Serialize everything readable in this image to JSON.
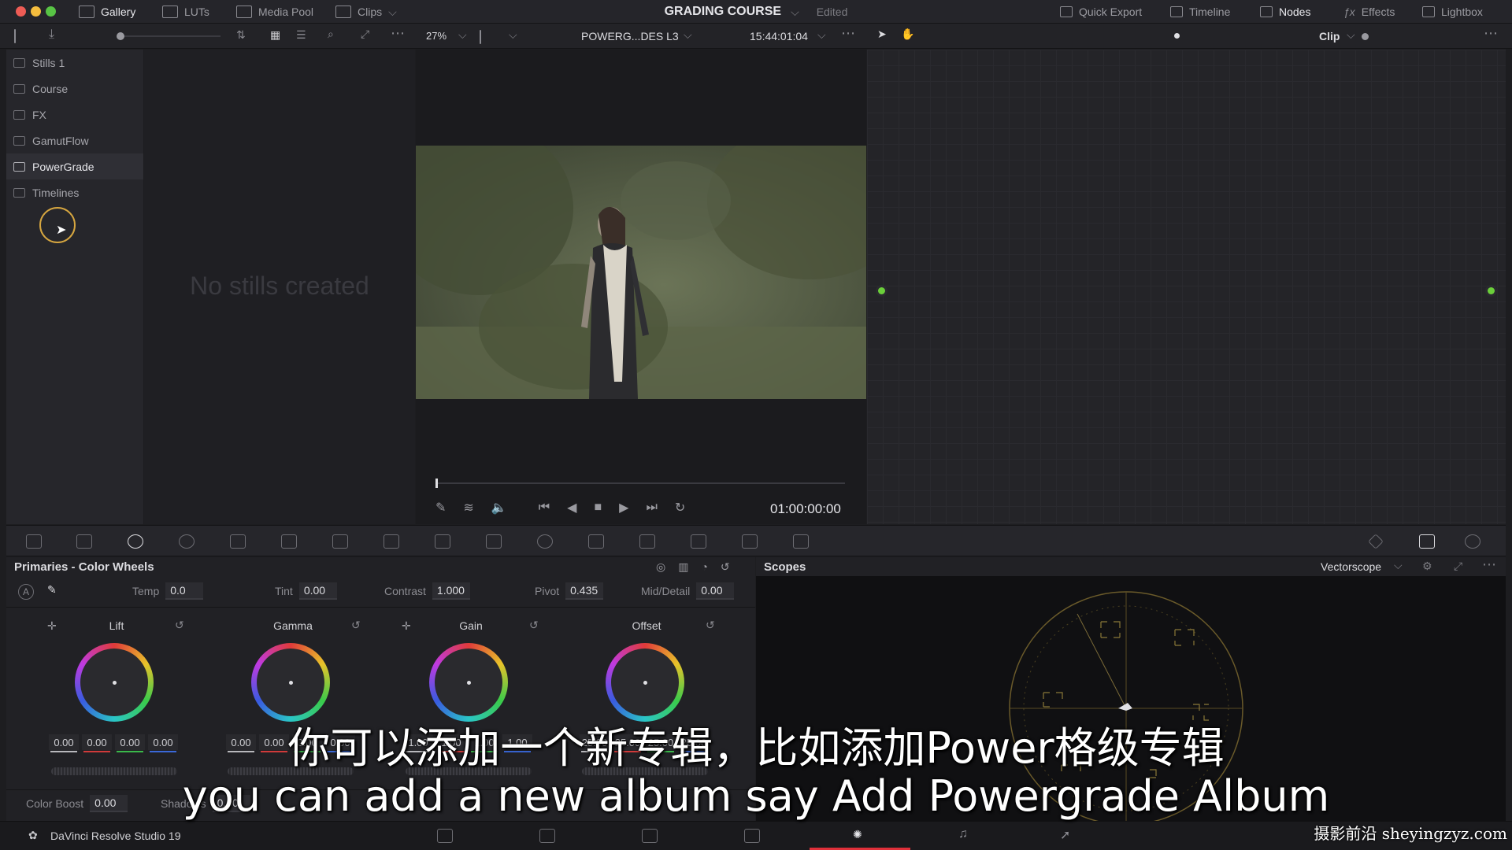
{
  "topbar": {
    "tabs": [
      {
        "label": "Gallery",
        "active": true
      },
      {
        "label": "LUTs",
        "active": false
      },
      {
        "label": "Media Pool",
        "active": false
      },
      {
        "label": "Clips",
        "active": false
      }
    ],
    "project_title": "GRADING COURSE",
    "status": "Edited",
    "right_tabs": [
      {
        "label": "Quick Export"
      },
      {
        "label": "Timeline"
      },
      {
        "label": "Nodes"
      },
      {
        "label": "Effects"
      },
      {
        "label": "Lightbox"
      }
    ]
  },
  "toolbar2": {
    "zoom": "27%",
    "clip_name": "POWERG...DES L3",
    "timecode": "15:44:01:04",
    "node_mode": "Clip"
  },
  "albums": [
    {
      "label": "Stills 1",
      "selected": false
    },
    {
      "label": "Course",
      "selected": false
    },
    {
      "label": "FX",
      "selected": false
    },
    {
      "label": "GamutFlow",
      "selected": false
    },
    {
      "label": "PowerGrade",
      "selected": true
    },
    {
      "label": "Timelines",
      "selected": false
    }
  ],
  "stills": {
    "empty_text": "No stills created"
  },
  "viewer": {
    "playhead_timecode": "01:00:00:00"
  },
  "primaries": {
    "title": "Primaries - Color Wheels",
    "params": {
      "temp_label": "Temp",
      "temp": "0.0",
      "tint_label": "Tint",
      "tint": "0.00",
      "contrast_label": "Contrast",
      "contrast": "1.000",
      "pivot_label": "Pivot",
      "pivot": "0.435",
      "middetail_label": "Mid/Detail",
      "middetail": "0.00"
    },
    "wheels": [
      {
        "label": "Lift",
        "values": [
          "0.00",
          "0.00",
          "0.00",
          "0.00"
        ]
      },
      {
        "label": "Gamma",
        "values": [
          "0.00",
          "0.00",
          "0.00",
          "0.00"
        ]
      },
      {
        "label": "Gain",
        "values": [
          "1.00",
          "1.00",
          "1.00",
          "1.00"
        ]
      },
      {
        "label": "Offset",
        "values": [
          "25.00",
          "25.00",
          "25.00",
          "25.00"
        ]
      }
    ],
    "bottom": {
      "color_boost_label": "Color Boost",
      "color_boost": "0.00",
      "shadows_label": "Shadows",
      "shadows": "0.00"
    }
  },
  "scopes": {
    "title": "Scopes",
    "mode": "Vectorscope"
  },
  "bottombar": {
    "app_name": "DaVinci Resolve Studio 19"
  },
  "subtitles": {
    "chinese": "你可以添加一个新专辑，比如添加Power格级专辑",
    "english": "you can add a new album say Add Powergrade Album"
  },
  "watermark": "摄影前沿 sheyingzyz.com",
  "colors": {
    "accent_red": "#e0303a",
    "node_green": "#6bcf3a",
    "cursor_ring": "#d6a640"
  }
}
